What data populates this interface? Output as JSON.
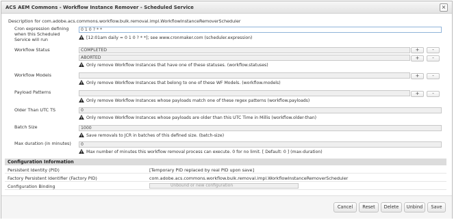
{
  "window": {
    "title": "ACS AEM Commons - Workflow Instance Remover - Scheduled Service",
    "close_glyph": "×"
  },
  "description": "Description for com.adobe.acs.commons.workflow.bulk.removal.impl.WorkflowInstanceRemoverScheduler",
  "fields": {
    "cron": {
      "label": "Cron expression defining when this Scheduled Service will run",
      "value": "0 1 0 ? * *",
      "hint": "[12:01am daily = 0 1 0 ? * *]; see www.cronmaker.com (scheduler.expression)"
    },
    "statuses": {
      "label": "Workflow Status",
      "values": [
        "COMPLETED",
        "ABORTED"
      ],
      "hint": "Only remove Workflow Instances that have one of these statuses. (workflow.statuses)"
    },
    "models": {
      "label": "Workflow Models",
      "value": "",
      "hint": "Only remove Workflow Instances that belong to one of these WF Models. (workflow.models)"
    },
    "payloads": {
      "label": "Payload Patterns",
      "value": "",
      "hint": "Only remove Workflow Instances whose payloads match one of these regex patterns (workflow.payloads)"
    },
    "older_than": {
      "label": "Older Than UTC TS",
      "value": "0",
      "hint": "Only remove Workflow Instances whose payloads are older than this UTC Time in Millis (workflow.older-than)"
    },
    "batch": {
      "label": "Batch Size",
      "value": "1000",
      "hint": "Save removals to JCR in batches of this defined size. (batch-size)"
    },
    "max_duration": {
      "label": "Max duration (in minutes)",
      "value": "0",
      "hint": "Max number of minutes this workflow removal process can execute. 0 for no limit. [ Default: 0 ] (max-duration)"
    }
  },
  "row_buttons": {
    "add": "+",
    "remove": "-"
  },
  "config": {
    "heading": "Configuration Information",
    "pid_label": "Persistent Identity (PID)",
    "pid_value": "[Temporary PID replaced by real PID upon save]",
    "fpid_label": "Factory Persistent Identifier (Factory PID)",
    "fpid_value": "com.adobe.acs.commons.workflow.bulk.removal.impl.WorkflowInstanceRemoverScheduler",
    "binding_label": "Configuration Binding",
    "binding_value": "Unbound or new configuration"
  },
  "footer": {
    "cancel": "Cancel",
    "reset": "Reset",
    "delete": "Delete",
    "unbind": "Unbind",
    "save": "Save"
  },
  "colors": {
    "warn": "#f0c020",
    "active_border": "#8fb3d9"
  }
}
